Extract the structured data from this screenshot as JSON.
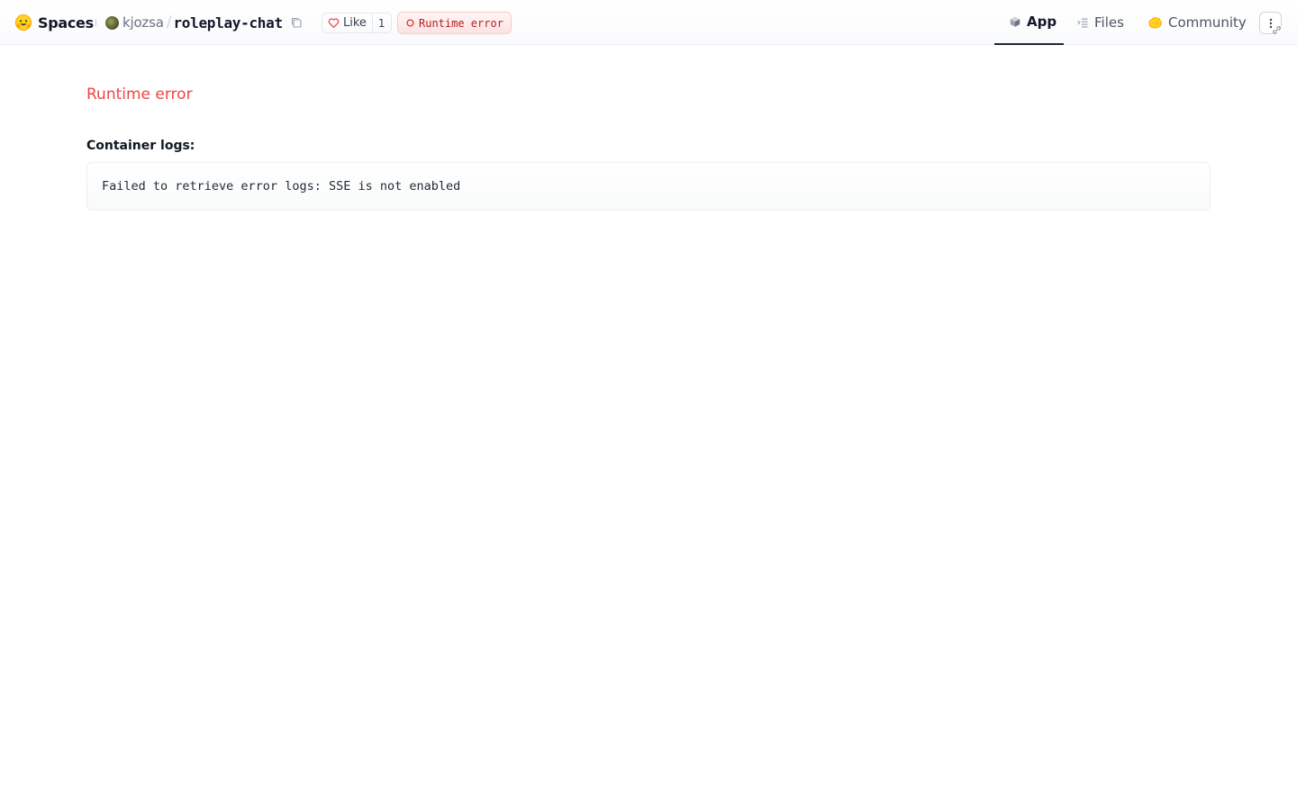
{
  "header": {
    "brand": "Spaces",
    "owner": "kjozsa",
    "separator": "/",
    "repo_name": "roleplay-chat",
    "like_label": "Like",
    "like_count": "1",
    "status": "Runtime error",
    "status_color": "#b91c1c"
  },
  "tabs": [
    {
      "label": "App",
      "icon": "app-cube-icon",
      "active": true
    },
    {
      "label": "Files",
      "icon": "files-icon",
      "active": false
    },
    {
      "label": "Community",
      "icon": "community-icon",
      "active": false
    }
  ],
  "main": {
    "error_title": "Runtime error",
    "error_color": "#ef4444",
    "logs_label": "Container logs:",
    "logs_text": "Failed to retrieve error logs: SSE is not enabled"
  }
}
